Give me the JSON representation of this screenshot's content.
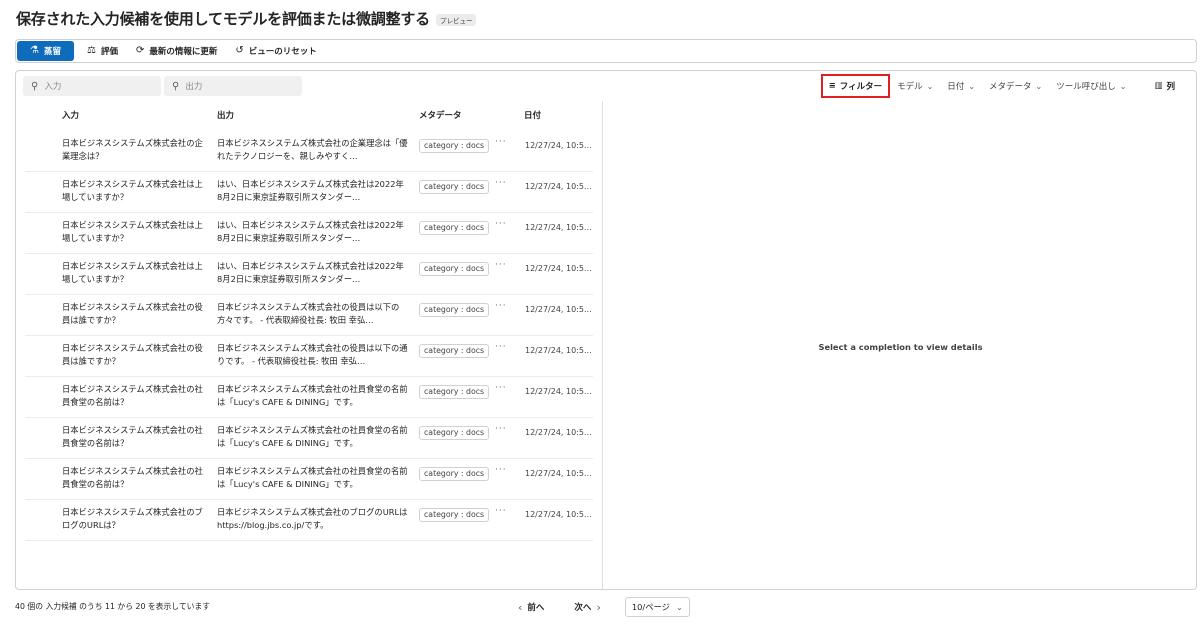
{
  "header": {
    "title": "保存された入力候補を使用してモデルを評価または微調整する",
    "badge": "プレビュー"
  },
  "toolbar": {
    "distill_label": "蒸留",
    "evaluate_label": "評価",
    "refresh_label": "最新の情報に更新",
    "reset_view_label": "ビューのリセット"
  },
  "search": {
    "input_placeholder": "入力",
    "output_placeholder": "出力"
  },
  "filters": {
    "filter_label": "フィルター",
    "model_label": "モデル",
    "date_label": "日付",
    "metadata_label": "メタデータ",
    "tool_call_label": "ツール呼び出し",
    "columns_label": "列"
  },
  "table": {
    "headers": {
      "input": "入力",
      "output": "出力",
      "metadata": "メタデータ",
      "date": "日付"
    },
    "rows": [
      {
        "input": "日本ビジネスシステムズ株式会社の企業理念は？",
        "output": "日本ビジネスシステムズ株式会社の企業理念は「優れたテクノロジーを、親しみやすく…",
        "tag": "category : docs",
        "date": "12/27/24, 10:5..."
      },
      {
        "input": "日本ビジネスシステムズ株式会社は上場していますか？",
        "output": "はい、日本ビジネスシステムズ株式会社は2022年8月2日に東京証券取引所スタンダー…",
        "tag": "category : docs",
        "date": "12/27/24, 10:5..."
      },
      {
        "input": "日本ビジネスシステムズ株式会社は上場していますか？",
        "output": "はい、日本ビジネスシステムズ株式会社は2022年8月2日に東京証券取引所スタンダー…",
        "tag": "category : docs",
        "date": "12/27/24, 10:5..."
      },
      {
        "input": "日本ビジネスシステムズ株式会社は上場していますか？",
        "output": "はい、日本ビジネスシステムズ株式会社は2022年8月2日に東京証券取引所スタンダー…",
        "tag": "category : docs",
        "date": "12/27/24, 10:5..."
      },
      {
        "input": "日本ビジネスシステムズ株式会社の役員は誰ですか？",
        "output": "日本ビジネスシステムズ株式会社の役員は以下の方々です。 - 代表取締役社長: 牧田 幸弘…",
        "tag": "category : docs",
        "date": "12/27/24, 10:5..."
      },
      {
        "input": "日本ビジネスシステムズ株式会社の役員は誰ですか？",
        "output": "日本ビジネスシステムズ株式会社の役員は以下の通りです。 - 代表取締役社長: 牧田 幸弘…",
        "tag": "category : docs",
        "date": "12/27/24, 10:5..."
      },
      {
        "input": "日本ビジネスシステムズ株式会社の社員食堂の名前は？",
        "output": "日本ビジネスシステムズ株式会社の社員食堂の名前は「Lucy's CAFE & DINING」です。",
        "tag": "category : docs",
        "date": "12/27/24, 10:5..."
      },
      {
        "input": "日本ビジネスシステムズ株式会社の社員食堂の名前は？",
        "output": "日本ビジネスシステムズ株式会社の社員食堂の名前は「Lucy's CAFE & DINING」です。",
        "tag": "category : docs",
        "date": "12/27/24, 10:5..."
      },
      {
        "input": "日本ビジネスシステムズ株式会社の社員食堂の名前は？",
        "output": "日本ビジネスシステムズ株式会社の社員食堂の名前は「Lucy's CAFE & DINING」です。",
        "tag": "category : docs",
        "date": "12/27/24, 10:5..."
      },
      {
        "input": "日本ビジネスシステムズ株式会社のブログのURLは？",
        "output": "日本ビジネスシステムズ株式会社のブログのURLはhttps://blog.jbs.co.jp/です。",
        "tag": "category : docs",
        "date": "12/27/24, 10:5..."
      }
    ]
  },
  "detail": {
    "empty_text": "Select a completion to view details"
  },
  "footer": {
    "info": "40 個の 入力候補 のうち 11 から 20 を表示しています",
    "prev_label": "前へ",
    "next_label": "次へ",
    "page_size": "10/ページ"
  },
  "colors": {
    "primary": "#0f6cbd",
    "highlight_border": "#e02020"
  }
}
